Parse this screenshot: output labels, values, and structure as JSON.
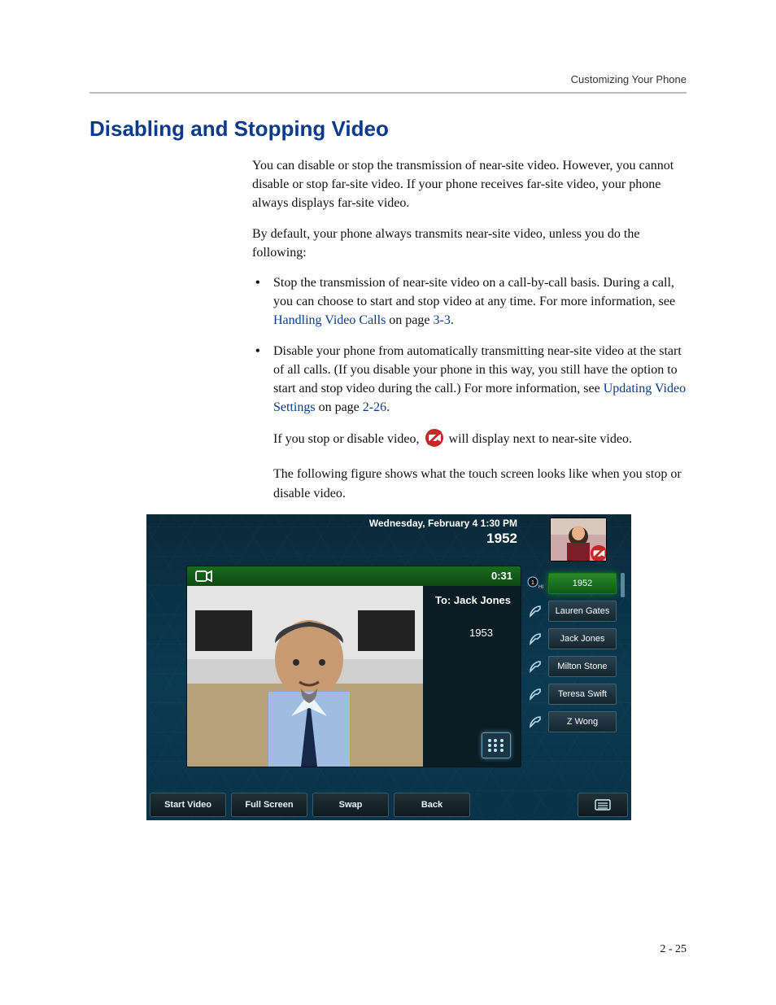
{
  "header": {
    "running": "Customizing Your Phone"
  },
  "section": {
    "title": "Disabling and Stopping Video"
  },
  "para": {
    "p1": "You can disable or stop the transmission of near-site video. However, you cannot disable or stop far-site video. If your phone receives far-site video, your phone always displays far-site video.",
    "p2": "By default, your phone always transmits near-site video, unless you do the following:",
    "b1a": "Stop the transmission of near-site video on a call-by-call basis. During a call, you can choose to start and stop video at any time. For more information, see ",
    "b1_link": "Handling Video Calls",
    "b1b": " on page ",
    "b1_page": "3-3",
    "b1c": ".",
    "b2a": "Disable your phone from automatically transmitting near-site video at the start of all calls. (If you disable your phone in this way, you still have the option to start and stop video during the call.) For more information, see ",
    "b2_link": "Updating Video Settings",
    "b2b": " on page ",
    "b2_page": "2-26",
    "b2c": ".",
    "p3a": "If you stop or disable video, ",
    "p3b": " will display next to near-site video.",
    "p4": "The following figure shows what the touch screen looks like when you stop or disable video."
  },
  "phone": {
    "datetime": "Wednesday, February 4  1:30 PM",
    "extension": "1952",
    "call": {
      "duration": "0:31",
      "to_label": "To: Jack Jones",
      "to_number": "1953"
    },
    "contacts": {
      "active_line": "1952",
      "items": [
        "Lauren Gates",
        "Jack Jones",
        "Milton Stone",
        "Teresa Swift",
        "Z Wong"
      ]
    },
    "softkeys": [
      "Start Video",
      "Full Screen",
      "Swap",
      "Back"
    ]
  },
  "footer": {
    "pagenum": "2 - 25"
  }
}
